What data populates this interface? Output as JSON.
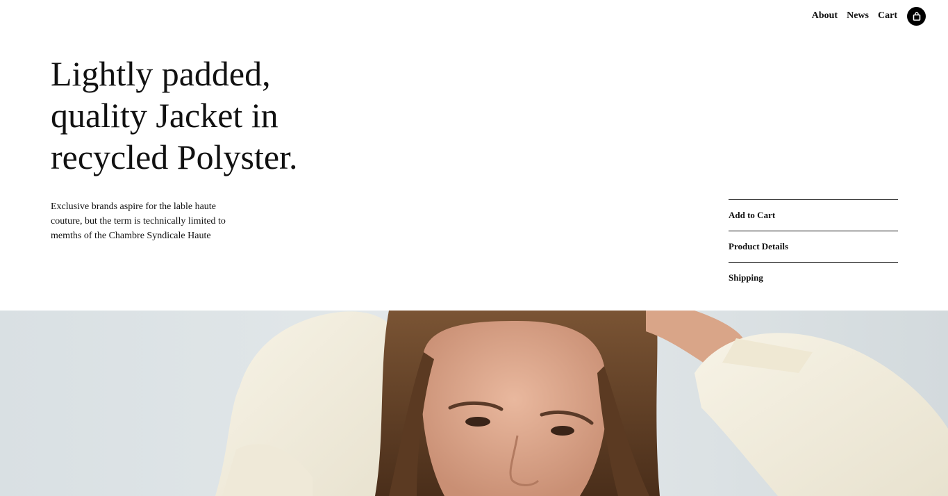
{
  "nav": {
    "items": [
      {
        "label": "About"
      },
      {
        "label": "News"
      },
      {
        "label": "Cart"
      }
    ],
    "cart_icon": "shopping-bag-icon"
  },
  "hero_text": {
    "headline": "Lightly padded, quality Jacket in recycled Polyster.",
    "description": "Exclusive brands aspire for the lable haute couture, but the term is technically limited to memths of the Chambre Syndicale Haute"
  },
  "product_menu": {
    "items": [
      {
        "label": "Add to Cart"
      },
      {
        "label": "Product Details"
      },
      {
        "label": "Shipping"
      }
    ]
  },
  "colors": {
    "background": "#ffffff",
    "text": "#111111",
    "accent": "#000000"
  }
}
